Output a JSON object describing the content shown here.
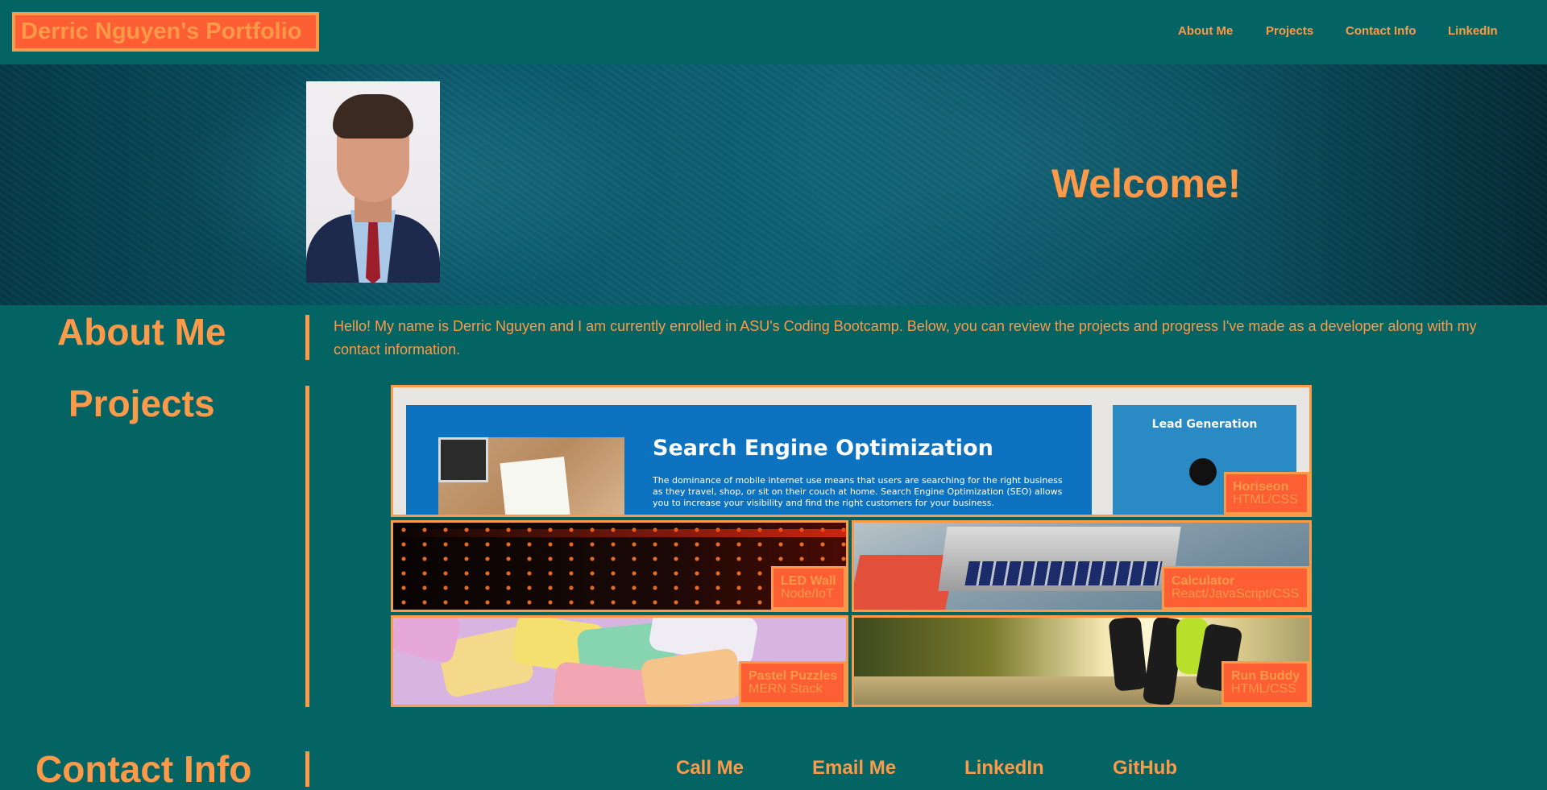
{
  "header": {
    "site_title": "Derric Nguyen's Portfolio",
    "nav": {
      "about": "About Me",
      "projects": "Projects",
      "contact": "Contact Info",
      "linkedin": "LinkedIn"
    }
  },
  "hero": {
    "welcome": "Welcome!"
  },
  "about": {
    "title": "About Me",
    "text": "Hello! My name is Derric Nguyen and I am currently enrolled in ASU's Coding Bootcamp. Below, you can review the projects and progress I've made as a developer along with my contact information."
  },
  "projects": {
    "title": "Projects",
    "items": [
      {
        "name": "Horiseon",
        "tech": "HTML/CSS",
        "screenshot_text": {
          "heading": "Search Engine Optimization",
          "paragraph": "The dominance of mobile internet use means that users are searching for the right business as they travel, shop, or sit on their couch at home. Search Engine Optimization (SEO) allows you to increase your visibility and find the right customers for your business.",
          "side_title": "Lead Generation"
        }
      },
      {
        "name": "LED Wall",
        "tech": "Node/IoT"
      },
      {
        "name": "Calculator",
        "tech": "React/JavaScript/CSS"
      },
      {
        "name": "Pastel Puzzles",
        "tech": "MERN Stack"
      },
      {
        "name": "Run Buddy",
        "tech": "HTML/CSS"
      }
    ]
  },
  "contact": {
    "title": "Contact Info",
    "links": {
      "call": "Call Me",
      "email": "Email Me",
      "linkedin": "LinkedIn",
      "github": "GitHub"
    }
  },
  "colors": {
    "background": "#046464",
    "accent_orange": "#fd9a49",
    "label_red_orange": "#fe5e34"
  }
}
